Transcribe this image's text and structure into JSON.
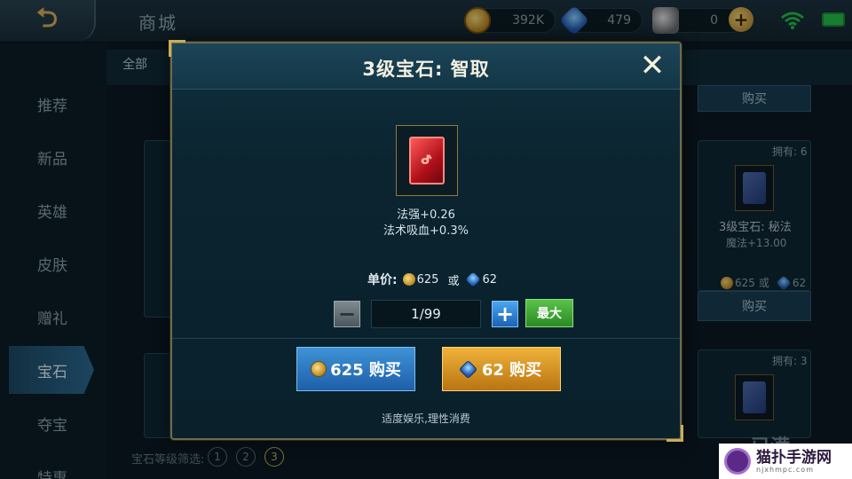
{
  "topbar": {
    "back_label": "⮌",
    "store_title": "商城",
    "gold_amount": "392K",
    "gem_amount": "479",
    "silver_amount": "0",
    "plus_label": "+"
  },
  "sidebar": {
    "items": [
      {
        "label": "推荐"
      },
      {
        "label": "新品"
      },
      {
        "label": "英雄"
      },
      {
        "label": "皮肤"
      },
      {
        "label": "赠礼"
      },
      {
        "label": "宝石"
      },
      {
        "label": "夺宝"
      },
      {
        "label": "特惠"
      }
    ],
    "active_index": 5
  },
  "shop_bg": {
    "tab_all": "全部",
    "top_buy": "购买",
    "card_owned": "拥有: 6",
    "card_name": "3级宝石: 秘法",
    "card_stat": "魔法+13.00",
    "card_price_gold": "625",
    "card_price_or": "或",
    "card_price_gem": "62",
    "card_buy": "购买",
    "card2_owned": "拥有: 3",
    "filter_label": "宝石等级筛选:",
    "filter_levels": [
      "1",
      "2",
      "3"
    ],
    "partial_text": "已满"
  },
  "modal": {
    "title": "3级宝石: 智取",
    "close_label": "✕",
    "gem_glyph": "ᕷ",
    "stats": [
      "法强+0.26",
      "法术吸血+0.3%"
    ],
    "price_label": "单价:",
    "price_gold": "625",
    "price_or": "或",
    "price_gem": "62",
    "quantity": "1/99",
    "minus_label": "−",
    "plus_label": "+",
    "max_label": "最大",
    "buy_gold_label": "625 购买",
    "buy_gem_label": "62 购买",
    "moderation_text": "适度娱乐,理性消费"
  },
  "watermark": {
    "main": "猫扑手游网",
    "sub": "njxhmpc.com"
  }
}
